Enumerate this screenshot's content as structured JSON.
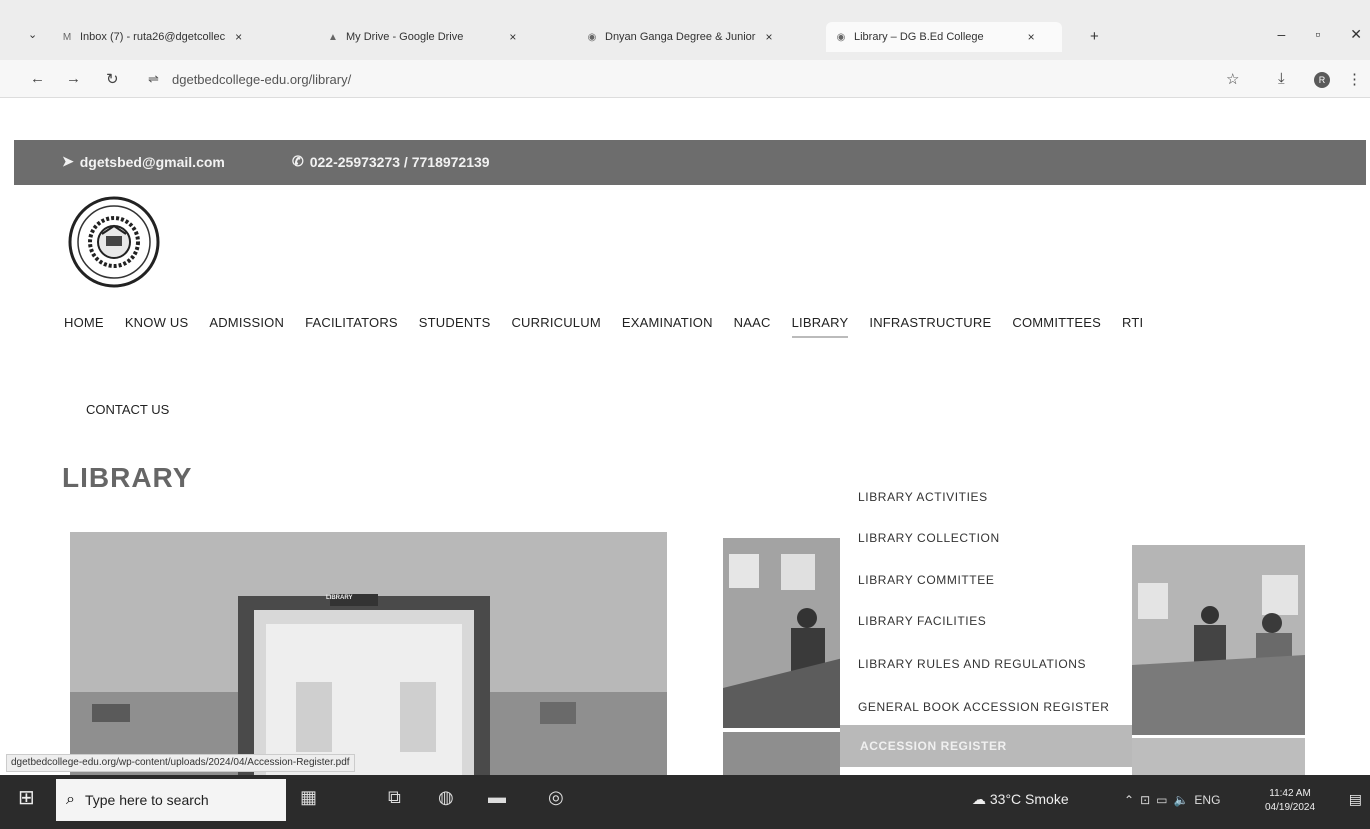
{
  "browser": {
    "tabs": [
      {
        "label": "Inbox (7) - ruta26@dgetcollec",
        "icon": "gmail-icon"
      },
      {
        "label": "My Drive - Google Drive",
        "icon": "drive-icon"
      },
      {
        "label": "Dnyan Ganga Degree & Junior",
        "icon": "site-icon"
      },
      {
        "label": "Library – DG B.Ed College",
        "icon": "site-icon",
        "active": true
      }
    ],
    "new_tab": "+",
    "url": "dgetbedcollege-edu.org/library/",
    "status_url": "dgetbedcollege-edu.org/wp-content/uploads/2024/04/Accession-Register.pdf",
    "profile_initial": "R"
  },
  "site": {
    "email": "dgetsbed@gmail.com",
    "phone": "022-25973273 / 7718972139",
    "nav": [
      "HOME",
      "KNOW US",
      "ADMISSION",
      "FACILITATORS",
      "STUDENTS",
      "CURRICULUM",
      "EXAMINATION",
      "NAAC",
      "LIBRARY",
      "INFRASTRUCTURE",
      "COMMITTEES",
      "RTI"
    ],
    "nav_active": "LIBRARY",
    "nav_contact": "CONTACT US",
    "page_title": "LIBRARY",
    "photo_sign": "LIBRARY",
    "library_menu": [
      "LIBRARY ACTIVITIES",
      "LIBRARY COLLECTION",
      "LIBRARY COMMITTEE",
      "LIBRARY FACILITIES",
      "LIBRARY RULES AND REGULATIONS",
      "GENERAL BOOK ACCESSION REGISTER"
    ],
    "submenu": "ACCESSION REGISTER"
  },
  "taskbar": {
    "search_placeholder": "Type here to search",
    "weather": "33°C Smoke",
    "lang": "ENG",
    "time": "11:42 AM",
    "date": "04/19/2024"
  },
  "colors": {
    "topstrip": "#6d6d6d",
    "title": "#666666",
    "taskbar": "#2b2b2b"
  }
}
